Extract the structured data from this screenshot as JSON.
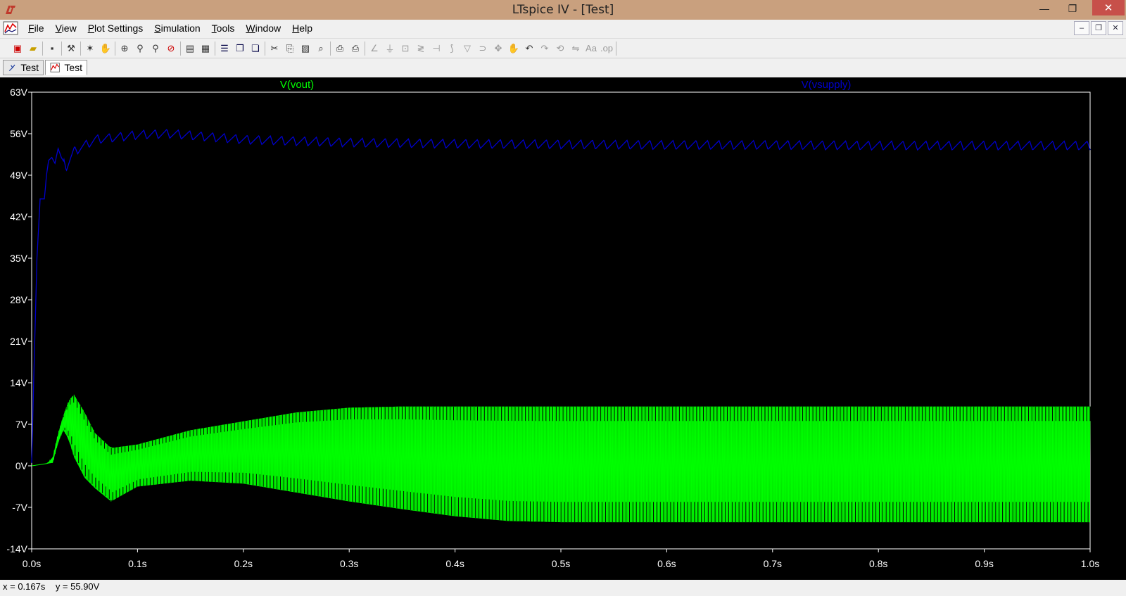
{
  "window": {
    "title": "LTspice IV - [Test]",
    "minimize": "—",
    "maximize": "❐",
    "close": "✕"
  },
  "menu": [
    {
      "label": "File",
      "hotkey": "F",
      "rest": "ile"
    },
    {
      "label": "View",
      "hotkey": "V",
      "rest": "iew"
    },
    {
      "label": "Plot Settings",
      "hotkey": "P",
      "rest": "lot Settings"
    },
    {
      "label": "Simulation",
      "hotkey": "S",
      "rest": "imulation"
    },
    {
      "label": "Tools",
      "hotkey": "T",
      "rest": "ools"
    },
    {
      "label": "Window",
      "hotkey": "W",
      "rest": "indow"
    },
    {
      "label": "Help",
      "hotkey": "H",
      "rest": "elp"
    }
  ],
  "mdi": {
    "minimize": "–",
    "restore": "❐",
    "close": "✕"
  },
  "tabs": [
    {
      "label": "Test",
      "icon": "schematic-icon",
      "active": false
    },
    {
      "label": "Test",
      "icon": "waveform-icon",
      "active": true
    }
  ],
  "status": {
    "x_readout": "x = 0.167s",
    "y_readout": "y = 55.90V"
  },
  "colors": {
    "background": "#000000",
    "grid": "#ffffff",
    "axis_text": "#ffffff",
    "vout": "#00ff00",
    "vsupply": "#0000cc",
    "titlebar": "#c9a07e"
  },
  "chart_data": {
    "type": "line",
    "title": "",
    "xlabel": "",
    "ylabel": "",
    "xlim": [
      0,
      1.0
    ],
    "ylim": [
      -14,
      63
    ],
    "x_ticks": [
      "0.0s",
      "0.1s",
      "0.2s",
      "0.3s",
      "0.4s",
      "0.5s",
      "0.6s",
      "0.7s",
      "0.8s",
      "0.9s",
      "1.0s"
    ],
    "y_ticks": [
      "63V",
      "56V",
      "49V",
      "42V",
      "35V",
      "28V",
      "21V",
      "14V",
      "7V",
      "0V",
      "-7V",
      "-14V"
    ],
    "series": [
      {
        "name": "V(vout)",
        "style": "envelope",
        "x": [
          0.0,
          0.015,
          0.02,
          0.025,
          0.03,
          0.035,
          0.04,
          0.05,
          0.06,
          0.075,
          0.1,
          0.15,
          0.2,
          0.25,
          0.3,
          0.35,
          0.4,
          0.45,
          0.5,
          0.6,
          0.7,
          0.8,
          0.9,
          1.0
        ],
        "upper": [
          0,
          0.4,
          1.5,
          5.5,
          8.5,
          11,
          12,
          9,
          5.5,
          3,
          3.6,
          6,
          7.5,
          9,
          9.8,
          10,
          10,
          10,
          10,
          10,
          10,
          10,
          10,
          10
        ],
        "lower": [
          0,
          0.4,
          0.5,
          4,
          6,
          4.5,
          1.5,
          -2,
          -3.8,
          -6,
          -3.5,
          -2.5,
          -3,
          -4.5,
          -6,
          -7.3,
          -8.5,
          -9.3,
          -9.5,
          -9.5,
          -9.5,
          -9.5,
          -9.5,
          -9.5
        ]
      },
      {
        "name": "V(vsupply)",
        "style": "line",
        "x": [
          0.0,
          0.002,
          0.005,
          0.008,
          0.012,
          0.014,
          0.016,
          0.019,
          0.022,
          0.025,
          0.028,
          0.033,
          0.04,
          0.05,
          0.06,
          0.07,
          0.08,
          0.1,
          0.13,
          0.2,
          0.3,
          0.4,
          0.5,
          0.6,
          0.7,
          0.8,
          0.9,
          1.0
        ],
        "values": [
          0.5,
          15,
          35,
          45,
          45,
          49,
          51.5,
          52,
          51,
          53.5,
          52,
          50.5,
          53,
          54,
          55,
          55.2,
          55.4,
          55.8,
          56,
          55,
          54.5,
          54.3,
          54.2,
          54.1,
          54.1,
          54,
          54,
          54
        ],
        "ripple": 1.5
      }
    ]
  }
}
